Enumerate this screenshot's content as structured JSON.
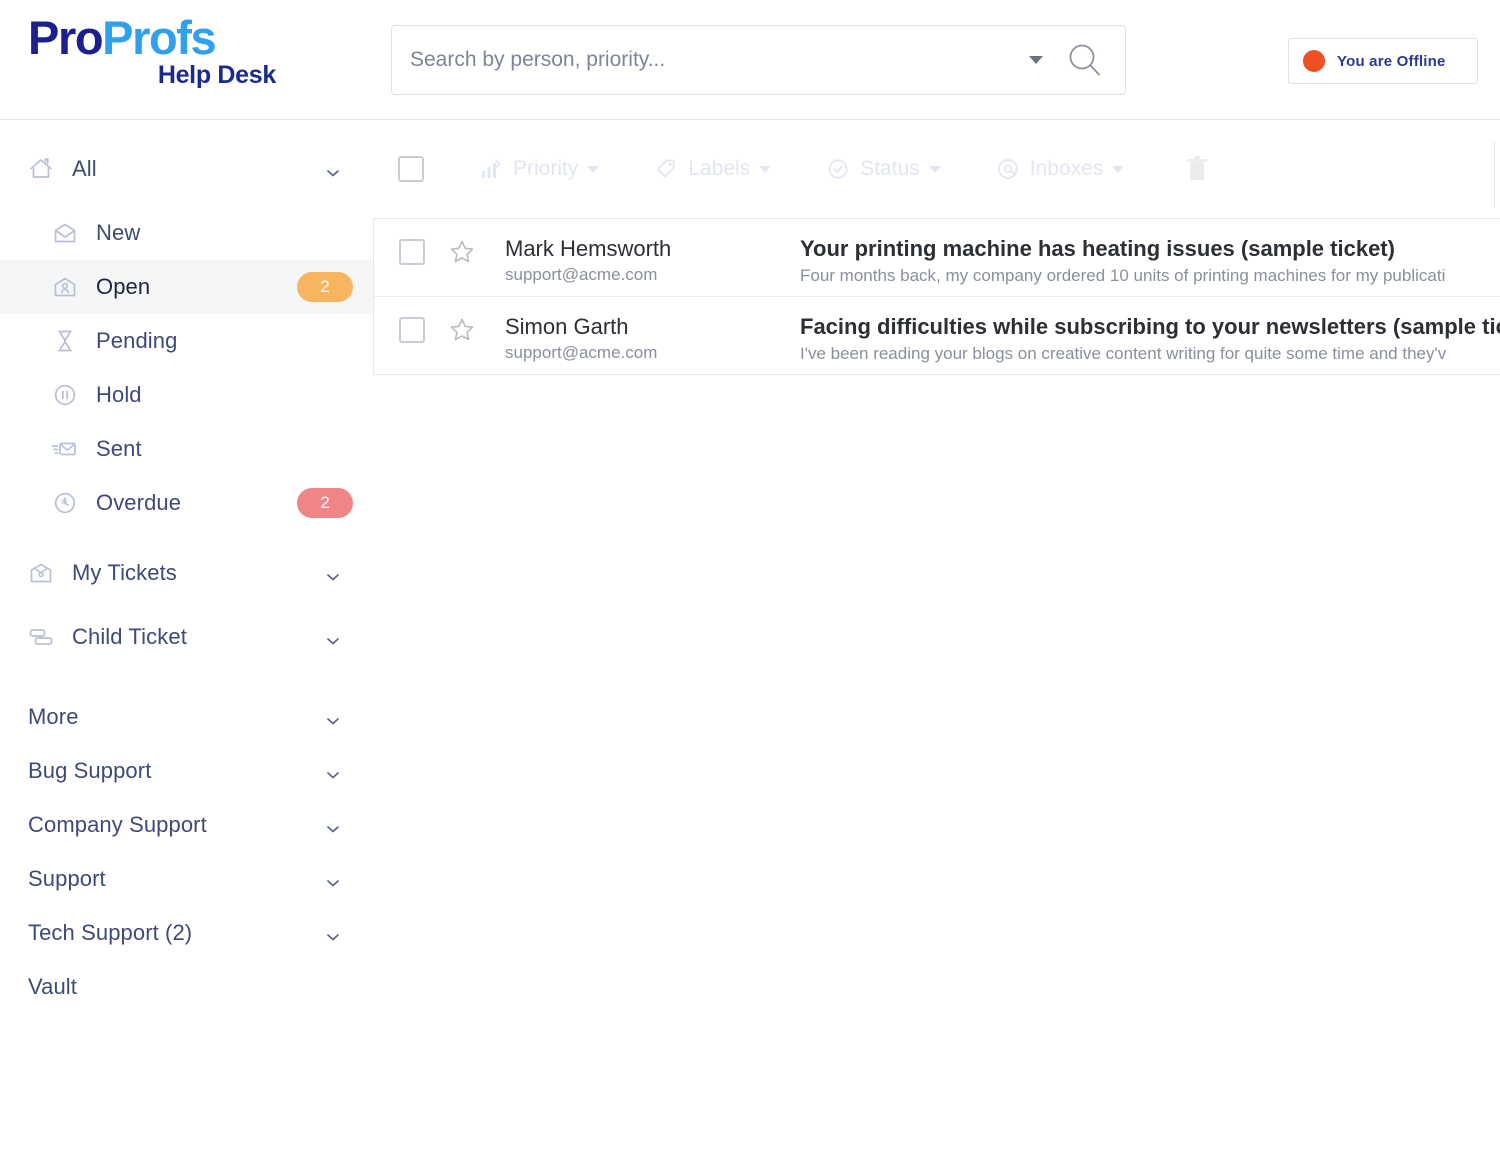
{
  "header": {
    "logo": {
      "primary": "Pro",
      "secondary": "Profs",
      "subtitle": "Help Desk"
    },
    "search": {
      "placeholder": "Search by person, priority...",
      "value": ""
    },
    "status": {
      "label": "You are Offline",
      "dot_color": "#f04e23"
    }
  },
  "sidebar": {
    "items": [
      {
        "label": "All",
        "icon": "home-icon",
        "level": "top",
        "chevron": true,
        "badge": null,
        "badge_color": null,
        "selected": false
      },
      {
        "label": "New",
        "icon": "envelope-open-icon",
        "level": "sub",
        "chevron": false,
        "badge": null,
        "badge_color": null,
        "selected": false
      },
      {
        "label": "Open",
        "icon": "open-ticket-icon",
        "level": "sub",
        "chevron": false,
        "badge": "2",
        "badge_color": "#f8b45e",
        "selected": true
      },
      {
        "label": "Pending",
        "icon": "hourglass-icon",
        "level": "sub",
        "chevron": false,
        "badge": null,
        "badge_color": null,
        "selected": false
      },
      {
        "label": "Hold",
        "icon": "pause-circle-icon",
        "level": "sub",
        "chevron": false,
        "badge": null,
        "badge_color": null,
        "selected": false
      },
      {
        "label": "Sent",
        "icon": "send-mail-icon",
        "level": "sub",
        "chevron": false,
        "badge": null,
        "badge_color": null,
        "selected": false
      },
      {
        "label": "Overdue",
        "icon": "clock-icon",
        "level": "sub",
        "chevron": false,
        "badge": "2",
        "badge_color": "#ef8585",
        "selected": false
      },
      {
        "label": "My Tickets",
        "icon": "inbox-mail-icon",
        "level": "top",
        "chevron": true,
        "badge": null,
        "badge_color": null,
        "selected": false
      },
      {
        "label": "Child Ticket",
        "icon": "child-ticket-icon",
        "level": "top",
        "chevron": true,
        "badge": null,
        "badge_color": null,
        "selected": false
      },
      {
        "label": "More",
        "icon": null,
        "level": "plain",
        "chevron": true,
        "badge": null,
        "badge_color": null,
        "selected": false
      },
      {
        "label": "Bug Support",
        "icon": null,
        "level": "plain",
        "chevron": true,
        "badge": null,
        "badge_color": null,
        "selected": false
      },
      {
        "label": "Company Support",
        "icon": null,
        "level": "plain",
        "chevron": true,
        "badge": null,
        "badge_color": null,
        "selected": false
      },
      {
        "label": "Support",
        "icon": null,
        "level": "plain",
        "chevron": true,
        "badge": null,
        "badge_color": null,
        "selected": false
      },
      {
        "label": "Tech Support (2)",
        "icon": null,
        "level": "plain",
        "chevron": true,
        "badge": null,
        "badge_color": null,
        "selected": false
      },
      {
        "label": "Vault",
        "icon": null,
        "level": "plain",
        "chevron": false,
        "badge": null,
        "badge_color": null,
        "selected": false
      }
    ]
  },
  "toolbar": {
    "select_all_checked": false,
    "filters": [
      {
        "label": "Priority",
        "icon": "priority-bars-icon",
        "caret": true
      },
      {
        "label": "Labels",
        "icon": "tag-icon",
        "caret": true
      },
      {
        "label": "Status",
        "icon": "check-circle-icon",
        "caret": true
      },
      {
        "label": "Inboxes",
        "icon": "at-sign-icon",
        "caret": true
      }
    ],
    "delete_icon": "trash-icon"
  },
  "tickets": [
    {
      "name": "Mark Hemsworth",
      "email": "support@acme.com",
      "subject": "Your printing machine has heating issues (sample ticket)",
      "preview": "Four months back, my company ordered 10 units of printing machines for my publicati",
      "starred": false,
      "checked": false
    },
    {
      "name": "Simon Garth",
      "email": "support@acme.com",
      "subject": "Facing difficulties while subscribing to your newsletters (sample ticket)",
      "preview": "I've been reading your blogs on creative content writing for quite some time and they'v",
      "starred": false,
      "checked": false
    }
  ],
  "colors": {
    "brand_dark": "#1b1f8f",
    "brand_light": "#2f9ff0",
    "sidebar_text": "#3e4a77",
    "badge_open": "#f8b45e",
    "badge_overdue": "#ef8585",
    "offline_dot": "#f04e23",
    "toolbar_muted": "#e2e6f2"
  }
}
